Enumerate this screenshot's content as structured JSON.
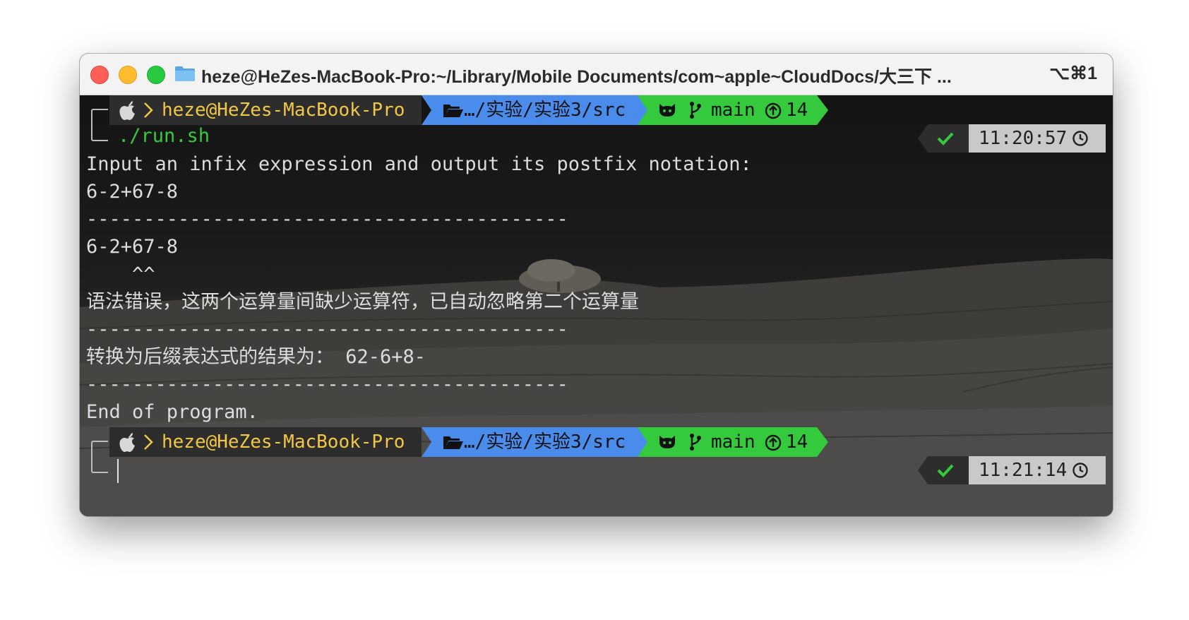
{
  "window": {
    "title": "heze@HeZes-MacBook-Pro:~/Library/Mobile Documents/com~apple~CloudDocs/大三下 ...",
    "shortcut": "⌥⌘1"
  },
  "colors": {
    "user": "#f2c744",
    "dir_segment": "#4a8cec",
    "git_segment": "#35c93e",
    "ok_check": "#35c93e",
    "time_segment": "#c9c9c9"
  },
  "prompt1": {
    "icons": [
      "apple-icon",
      "chevron-right-icon",
      "folder-open-icon",
      "github-cat-icon",
      "git-branch-icon",
      "arrow-up-circle-icon"
    ],
    "user": "heze@HeZes-MacBook-Pro",
    "dir": "…/实验/实验3/src",
    "branch": "main",
    "ahead": "14",
    "command": "./run.sh",
    "time": "11:20:57"
  },
  "output": [
    "Input an infix expression and output its postfix notation:",
    "6-2+67-8",
    "------------------------------------------",
    "6-2+67-8",
    "    ^^",
    "语法错误，这两个运算量间缺少运算符，已自动忽略第二个运算量",
    "------------------------------------------",
    "转换为后缀表达式的结果为： 62-6+8-",
    "------------------------------------------",
    "End of program."
  ],
  "prompt2": {
    "user": "heze@HeZes-MacBook-Pro",
    "dir": "…/实验/实验3/src",
    "branch": "main",
    "ahead": "14",
    "time": "11:21:14"
  }
}
